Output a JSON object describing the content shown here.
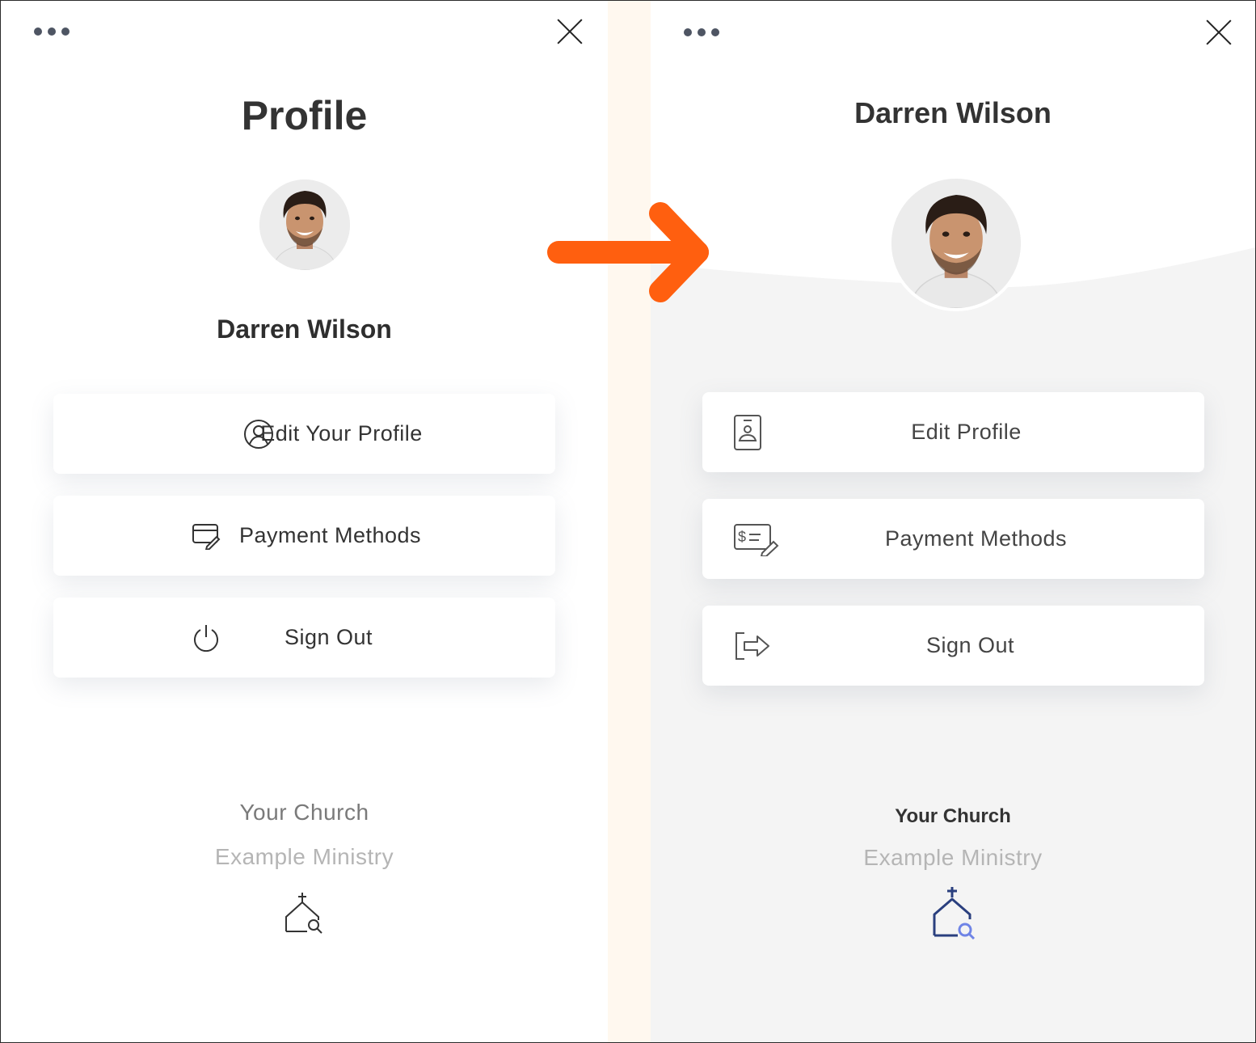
{
  "left_panel": {
    "title": "Profile",
    "user_name": "Darren Wilson",
    "menu": [
      {
        "label": "Edit Your Profile",
        "icon": "user-circle-icon"
      },
      {
        "label": "Payment Methods",
        "icon": "card-edit-icon"
      },
      {
        "label": "Sign Out",
        "icon": "power-icon"
      }
    ],
    "footer": {
      "church_label": "Your Church",
      "ministry": "Example Ministry",
      "icon": "church-search-icon"
    }
  },
  "right_panel": {
    "user_name": "Darren Wilson",
    "menu": [
      {
        "label": "Edit Profile",
        "icon": "id-badge-icon"
      },
      {
        "label": "Payment Methods",
        "icon": "check-edit-icon"
      },
      {
        "label": "Sign Out",
        "icon": "logout-arrow-icon"
      }
    ],
    "footer": {
      "church_label": "Your Church",
      "ministry": "Example Ministry",
      "icon": "church-search-icon"
    }
  },
  "colors": {
    "arrow": "#ff5f0f",
    "right_background": "#f4f4f4",
    "gutter": "#fff8ef",
    "church_icon_dark": "#2a3f7e",
    "church_icon_accent": "#6f84e6"
  }
}
